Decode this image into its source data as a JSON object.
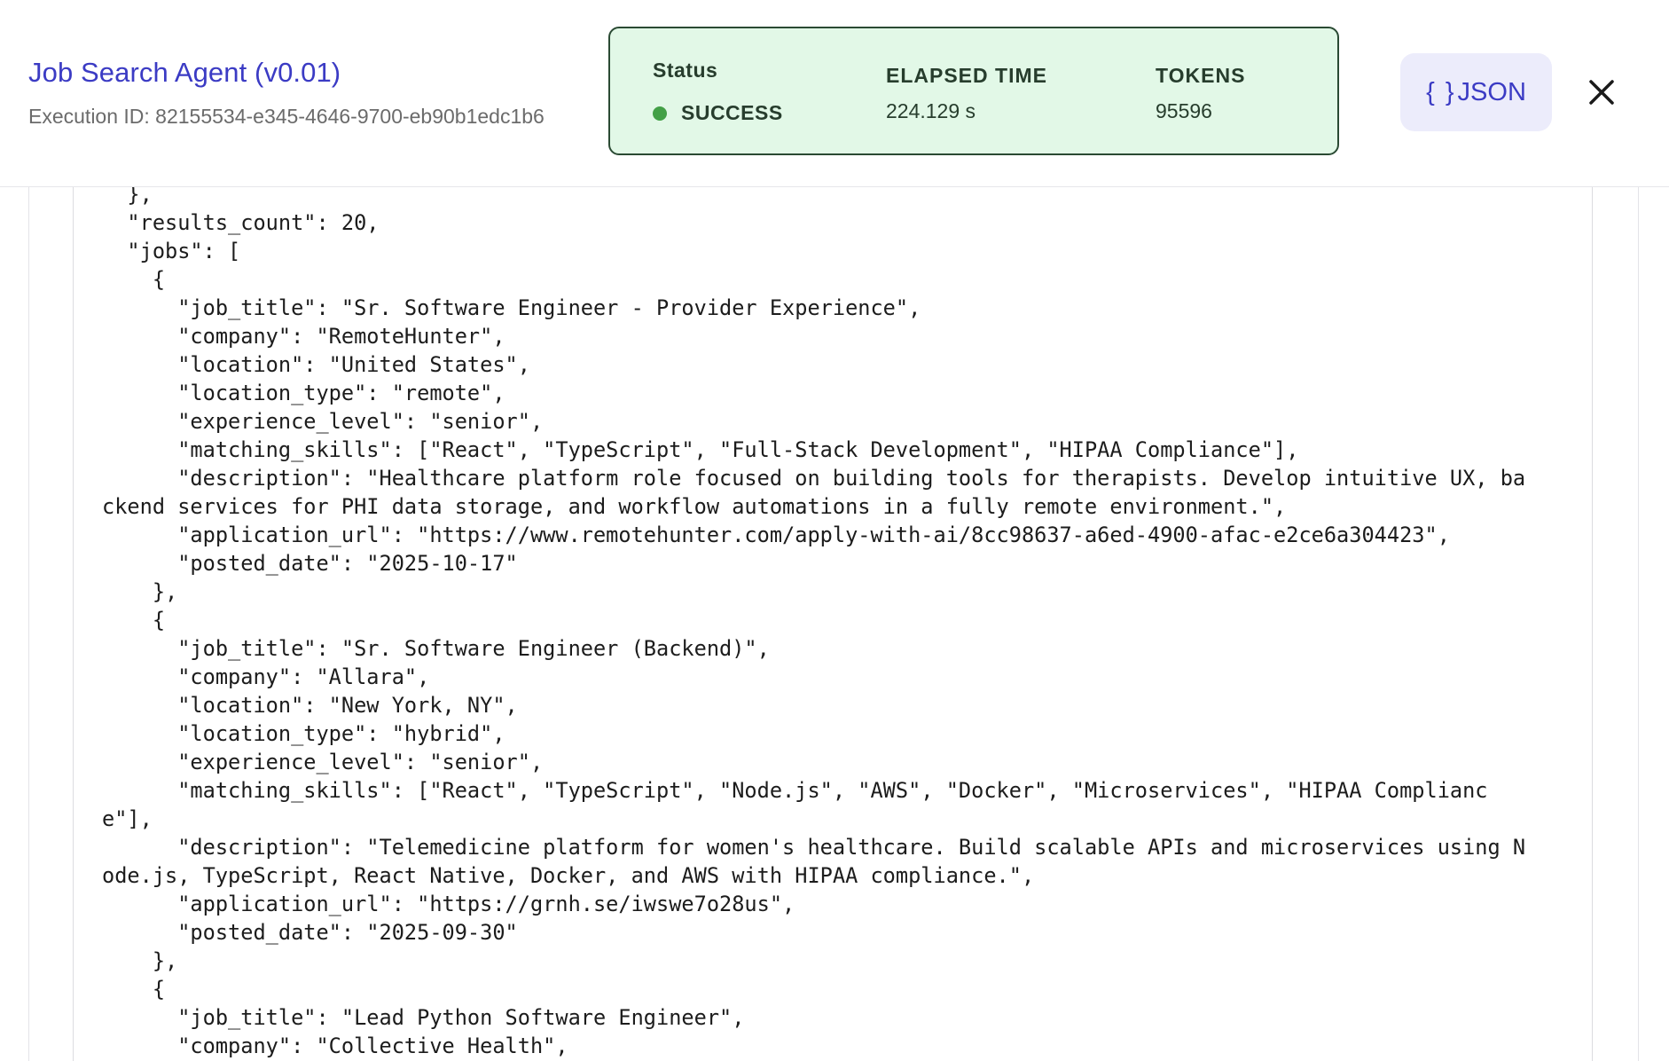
{
  "header": {
    "title": "Job Search Agent (v0.01)",
    "execution_id": "Execution ID: 82155534-e345-4646-9700-eb90b1edc1b6"
  },
  "status_card": {
    "status_label": "Status",
    "status_value": "SUCCESS",
    "elapsed_label": "ELAPSED TIME",
    "elapsed_value": "224.129 s",
    "tokens_label": "TOKENS",
    "tokens_value": "95596"
  },
  "actions": {
    "json_button_label": "JSON",
    "json_icon": "braces-icon",
    "close_icon": "close-icon"
  },
  "colors": {
    "accent": "#3b3bc4",
    "success_bg": "#e2f8e7",
    "success_border": "#2a4a33",
    "success_dot": "#43a047"
  },
  "json_output": {
    "lines": [
      "  },",
      "  \"results_count\": 20,",
      "  \"jobs\": [",
      "    {",
      "      \"job_title\": \"Sr. Software Engineer - Provider Experience\",",
      "      \"company\": \"RemoteHunter\",",
      "      \"location\": \"United States\",",
      "      \"location_type\": \"remote\",",
      "      \"experience_level\": \"senior\",",
      "      \"matching_skills\": [\"React\", \"TypeScript\", \"Full-Stack Development\", \"HIPAA Compliance\"],",
      "      \"description\": \"Healthcare platform role focused on building tools for therapists. Develop intuitive UX, ba",
      "ckend services for PHI data storage, and workflow automations in a fully remote environment.\",",
      "      \"application_url\": \"https://www.remotehunter.com/apply-with-ai/8cc98637-a6ed-4900-afac-e2ce6a304423\",",
      "      \"posted_date\": \"2025-10-17\"",
      "    },",
      "    {",
      "      \"job_title\": \"Sr. Software Engineer (Backend)\",",
      "      \"company\": \"Allara\",",
      "      \"location\": \"New York, NY\",",
      "      \"location_type\": \"hybrid\",",
      "      \"experience_level\": \"senior\",",
      "      \"matching_skills\": [\"React\", \"TypeScript\", \"Node.js\", \"AWS\", \"Docker\", \"Microservices\", \"HIPAA Complianc",
      "e\"],",
      "      \"description\": \"Telemedicine platform for women's healthcare. Build scalable APIs and microservices using N",
      "ode.js, TypeScript, React Native, Docker, and AWS with HIPAA compliance.\",",
      "      \"application_url\": \"https://grnh.se/iwswe7o28us\",",
      "      \"posted_date\": \"2025-09-30\"",
      "    },",
      "    {",
      "      \"job_title\": \"Lead Python Software Engineer\",",
      "      \"company\": \"Collective Health\","
    ]
  }
}
